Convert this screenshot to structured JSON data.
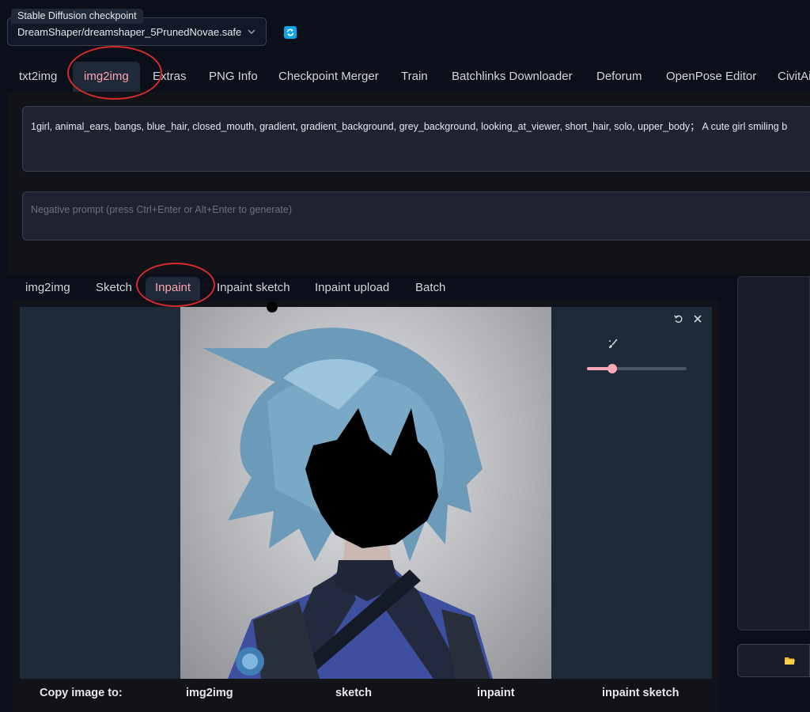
{
  "checkpoint": {
    "label": "Stable Diffusion checkpoint",
    "value": "DreamShaper/dreamshaper_5PrunedNovae.safe",
    "dropdown_icon": "chevron-down-icon",
    "refresh_icon": "refresh-icon"
  },
  "top_tabs": [
    "txt2img",
    "img2img",
    "Extras",
    "PNG Info",
    "Checkpoint Merger",
    "Train",
    "Batchlinks Downloader",
    "Deforum",
    "OpenPose Editor",
    "CivitAi"
  ],
  "top_tab_selected": "img2img",
  "prompt": {
    "value": "1girl, animal_ears, bangs, blue_hair, closed_mouth, gradient, gradient_background, grey_background, looking_at_viewer, short_hair, solo, upper_body；  A cute girl smiling b"
  },
  "negative_prompt": {
    "placeholder": "Negative prompt (press Ctrl+Enter or Alt+Enter to generate)"
  },
  "sub_tabs": [
    "img2img",
    "Sketch",
    "Inpaint",
    "Inpaint sketch",
    "Inpaint upload",
    "Batch"
  ],
  "sub_tab_selected": "Inpaint",
  "editor": {
    "undo_icon": "undo-icon",
    "close_icon": "close-icon",
    "brush_icon": "brush-icon",
    "brush_size_fraction": 0.25
  },
  "copy_row": {
    "label": "Copy image to:",
    "targets": [
      "img2img",
      "sketch",
      "inpaint",
      "inpaint sketch"
    ]
  },
  "folder_icon": "folder-icon",
  "colors": {
    "accent": "#fda4af",
    "background": "#0b0f19",
    "annotation": "#d52b2b"
  }
}
